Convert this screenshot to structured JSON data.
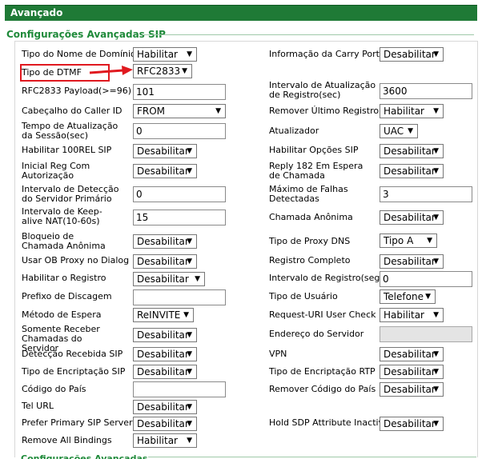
{
  "header": {
    "title": "Avançado"
  },
  "section": {
    "title": "Configurações Avançadas SIP"
  },
  "footer_section": {
    "title": "Configurações Avançadas"
  },
  "colors": {
    "header_green": "#1f7a36",
    "section_green": "#1f8a3a",
    "highlight_red": "#e0191f"
  },
  "left": {
    "domain_name_type": {
      "label": "Tipo do Nome de Domínio",
      "value": "Habilitar"
    },
    "dtmf_type": {
      "label": "Tipo de DTMF",
      "value": "RFC2833"
    },
    "rfc2833_payload": {
      "label": "RFC2833 Payload(>=96)",
      "value": "101"
    },
    "caller_id_header": {
      "label": "Cabeçalho do Caller ID",
      "value": "FROM"
    },
    "session_refresh": {
      "label": "Tempo de Atualização da Sessão(sec)",
      "value": "0"
    },
    "enable_100rel": {
      "label": "Habilitar 100REL SIP",
      "value": "Desabilitar"
    },
    "initial_reg_auth": {
      "label": "Inicial Reg Com Autorização",
      "value": "Desabilitar"
    },
    "primary_detect_interval": {
      "label": "Intervalo de Detecção do Servidor Primário",
      "value": "0"
    },
    "keepalive_interval": {
      "label": "Intervalo de Keep-alive NAT(10-60s)",
      "value": "15"
    },
    "anonymous_block": {
      "label": "Bloqueio de Chamada Anônima",
      "value": "Desabilitar"
    },
    "ob_proxy_dialog": {
      "label": "Usar OB Proxy no Dialog",
      "value": "Desabilitar"
    },
    "enable_register": {
      "label": "Habilitar o Registro",
      "value": "Desabilitar"
    },
    "dial_prefix": {
      "label": "Prefixo de Discagem",
      "value": ""
    },
    "hold_method": {
      "label": "Método de Espera",
      "value": "ReINVITE"
    },
    "server_calls_only": {
      "label": "Somente Receber Chamadas do Servidor",
      "value": "Desabilitar"
    },
    "sip_detect": {
      "label": "Detecção Recebida SIP",
      "value": "Desabilitar"
    },
    "sip_encrypt": {
      "label": "Tipo de Encriptação SIP",
      "value": "Desabilitar"
    },
    "country_code": {
      "label": "Código do País",
      "value": ""
    },
    "tel_url": {
      "label": "Tel URL",
      "value": "Desabilitar"
    },
    "prefer_primary": {
      "label": "Prefer Primary SIP Server",
      "value": "Desabilitar"
    },
    "remove_bindings": {
      "label": "Remove All Bindings",
      "value": "Habilitar"
    }
  },
  "right": {
    "carry_port_info": {
      "label": "Informação da Carry Port",
      "value": "Desabilitar"
    },
    "reg_refresh_interval": {
      "label": "Intervalo de Atualização de Registro(sec)",
      "value": "3600"
    },
    "remove_last_reg": {
      "label": "Remover Último Registro",
      "value": "Habilitar"
    },
    "refresher": {
      "label": "Atualizador",
      "value": "UAC"
    },
    "enable_options": {
      "label": "Habilitar Opções SIP",
      "value": "Desabilitar"
    },
    "reply_182": {
      "label": "Reply 182 Em Espera de Chamada",
      "value": "Desabilitar"
    },
    "max_failures": {
      "label": "Máximo de Falhas Detectadas",
      "value": "3"
    },
    "anonymous_call": {
      "label": "Chamada Anônima",
      "value": "Desabilitar"
    },
    "dns_proxy_type": {
      "label": "Tipo de Proxy DNS",
      "value": "Tipo A"
    },
    "full_register": {
      "label": "Registro Completo",
      "value": "Desabilitar"
    },
    "register_interval": {
      "label": "Intervalo de Registro(seg)",
      "value": "0"
    },
    "user_type": {
      "label": "Tipo de Usuário",
      "value": "Telefone"
    },
    "request_uri_check": {
      "label": "Request-URI User Check",
      "value": "Habilitar"
    },
    "server_address": {
      "label": "Endereço do Servidor",
      "value": ""
    },
    "vpn": {
      "label": "VPN",
      "value": "Desabilitar"
    },
    "rtp_encrypt": {
      "label": "Tipo de Encriptação RTP",
      "value": "Desabilitar"
    },
    "remove_country_code": {
      "label": "Remover Código do País",
      "value": "Desabilitar"
    },
    "hold_sdp_inactive": {
      "label": "Hold SDP Attribute Inactive",
      "value": "Desabilitar"
    }
  }
}
